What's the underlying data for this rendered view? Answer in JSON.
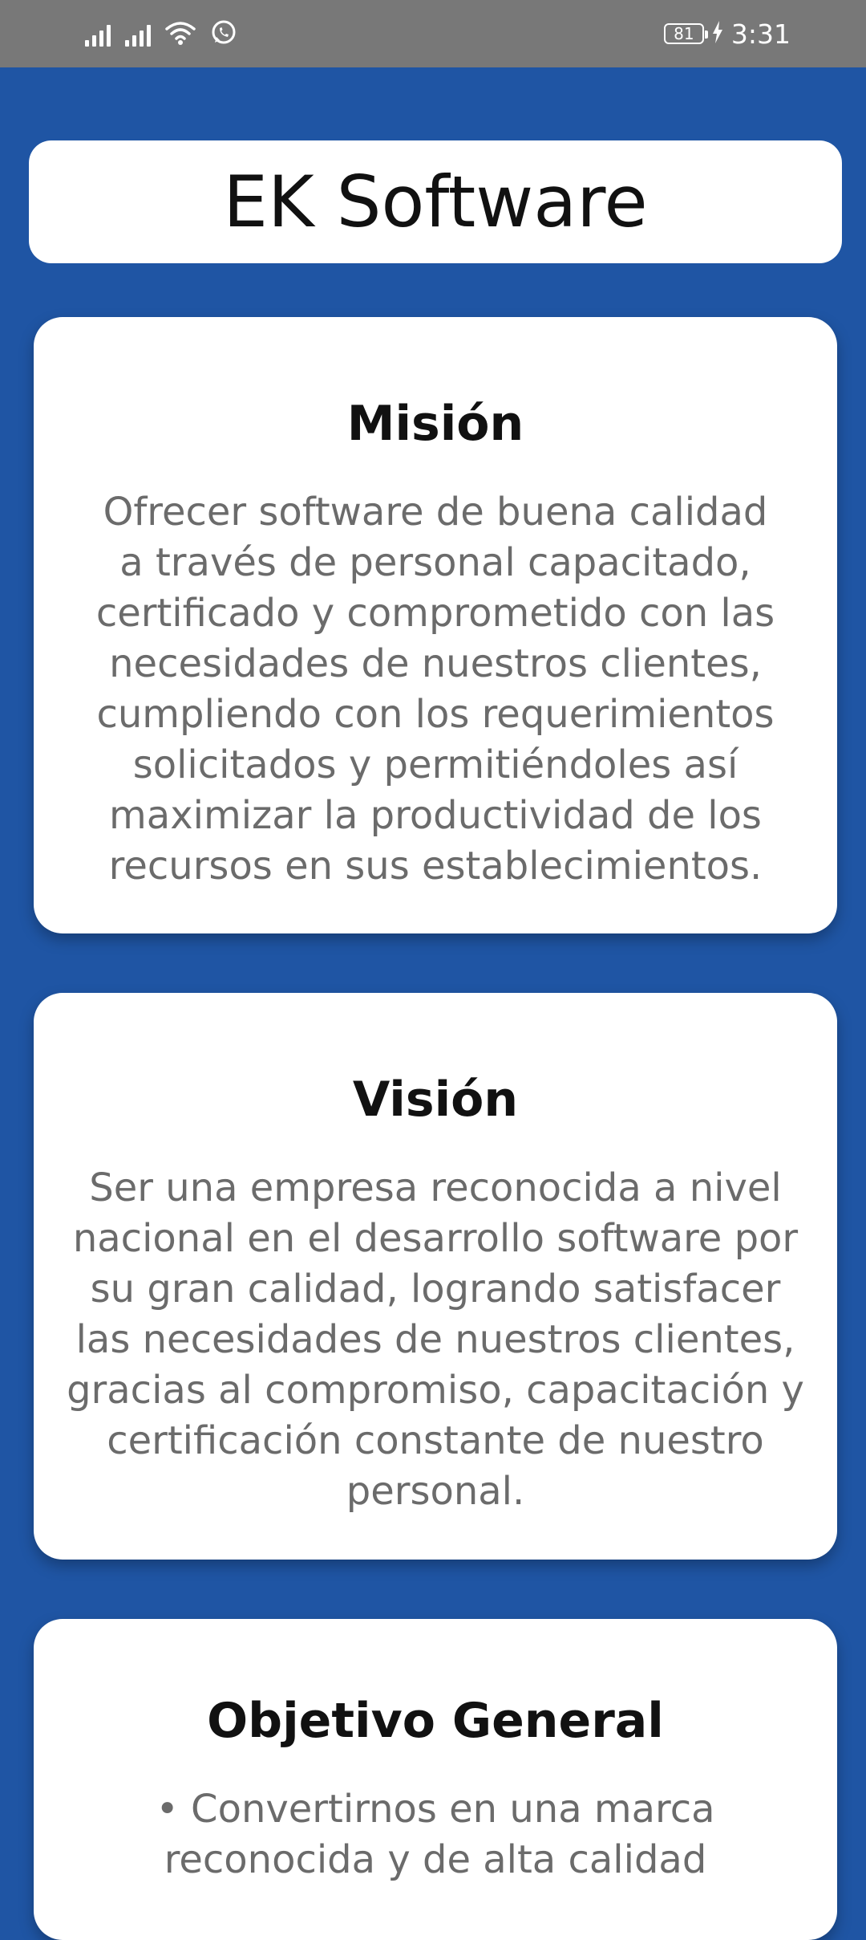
{
  "status_bar": {
    "time": "3:31",
    "battery_level": "81",
    "icons": [
      "signal-icon",
      "signal-icon",
      "wifi-icon",
      "whatsapp-icon",
      "battery-icon",
      "charging-icon"
    ]
  },
  "header": {
    "title": "EK Software"
  },
  "sections": {
    "mision": {
      "title": "Misión",
      "text": "Ofrecer software de buena calidad a través de personal capacitado, certificado y comprometido con las necesidades de nuestros clientes, cumpliendo con los requerimientos solicitados y permitiéndoles así maximizar la productividad de los recursos en sus establecimientos."
    },
    "vision": {
      "title": "Visión",
      "text": "Ser una empresa reconocida a nivel nacional en el desarrollo software por su gran calidad, logrando satisfacer las necesidades de nuestros clientes, gracias al compromiso, capacitación y certificación constante de nuestro personal."
    },
    "objetivo": {
      "title": "Objetivo General",
      "text": "• Convertirnos en una marca reconocida y de alta calidad"
    }
  },
  "colors": {
    "background": "#1f55a4",
    "status_bar": "#787878",
    "card": "#ffffff",
    "title_text": "#111111",
    "body_text": "#6b6b6b"
  }
}
